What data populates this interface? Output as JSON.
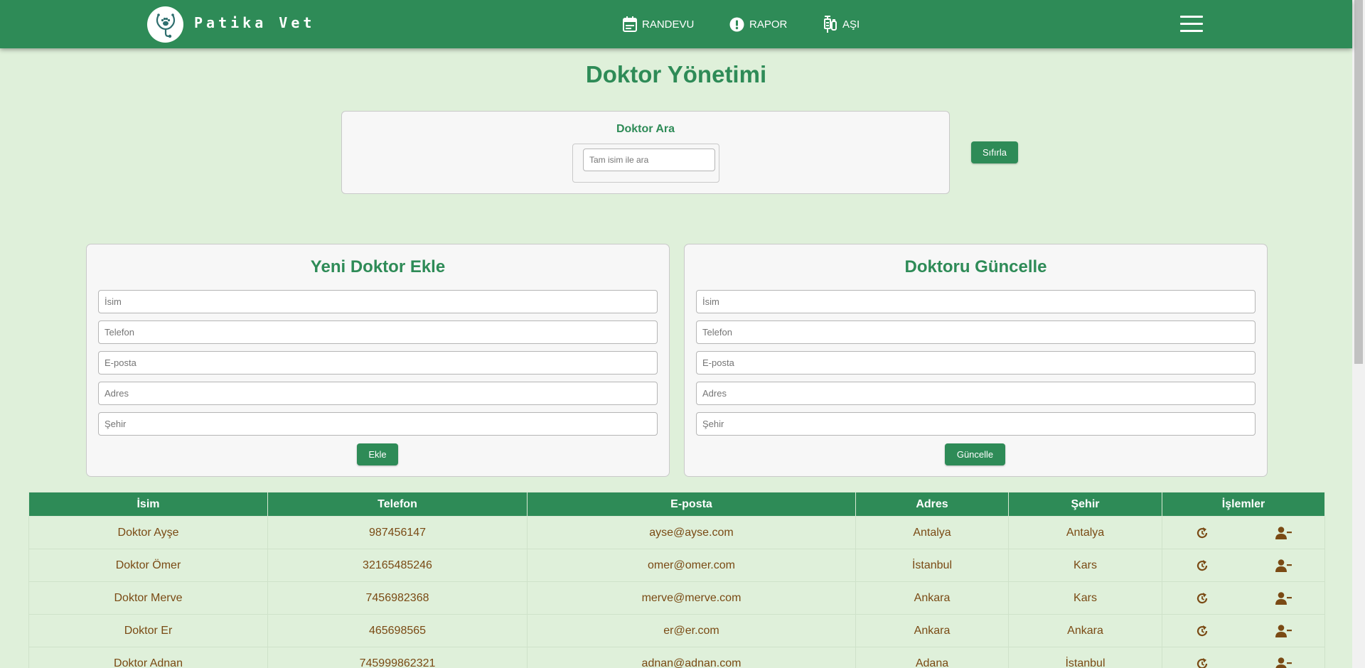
{
  "brand": {
    "name": "Patika Vet",
    "logo_icon": "stethoscope-paw-icon"
  },
  "nav": [
    {
      "label": "RANDEVU",
      "icon": "calendar-icon"
    },
    {
      "label": "RAPOR",
      "icon": "alert-circle-icon"
    },
    {
      "label": "AŞI",
      "icon": "syringe-icon"
    }
  ],
  "page": {
    "title": "Doktor Yönetimi"
  },
  "search": {
    "title": "Doktor Ara",
    "placeholder": "Tam isim ile ara",
    "reset_label": "Sıfırla"
  },
  "add_form": {
    "title": "Yeni Doktor Ekle",
    "fields": [
      "İsim",
      "Telefon",
      "E-posta",
      "Adres",
      "Şehir"
    ],
    "submit_label": "Ekle"
  },
  "update_form": {
    "title": "Doktoru Güncelle",
    "fields": [
      "İsim",
      "Telefon",
      "E-posta",
      "Adres",
      "Şehir"
    ],
    "submit_label": "Güncelle"
  },
  "table": {
    "headers": [
      "İsim",
      "Telefon",
      "E-posta",
      "Adres",
      "Şehir",
      "İşlemler"
    ],
    "rows": [
      {
        "name": "Doktor Ayşe",
        "phone": "987456147",
        "email": "ayse@ayse.com",
        "address": "Antalya",
        "city": "Antalya"
      },
      {
        "name": "Doktor Ömer",
        "phone": "32165485246",
        "email": "omer@omer.com",
        "address": "İstanbul",
        "city": "Kars"
      },
      {
        "name": "Doktor Merve",
        "phone": "7456982368",
        "email": "merve@merve.com",
        "address": "Ankara",
        "city": "Kars"
      },
      {
        "name": "Doktor Er",
        "phone": "465698565",
        "email": "er@er.com",
        "address": "Ankara",
        "city": "Ankara"
      },
      {
        "name": "Doktor Adnan",
        "phone": "745999862321",
        "email": "adnan@adnan.com",
        "address": "Adana",
        "city": "İstanbul"
      }
    ],
    "row_actions": [
      "refresh-icon",
      "remove-user-icon"
    ]
  },
  "colors": {
    "primary": "#2e8b57",
    "background": "#dff0da",
    "text_brown": "#7a4a14"
  }
}
